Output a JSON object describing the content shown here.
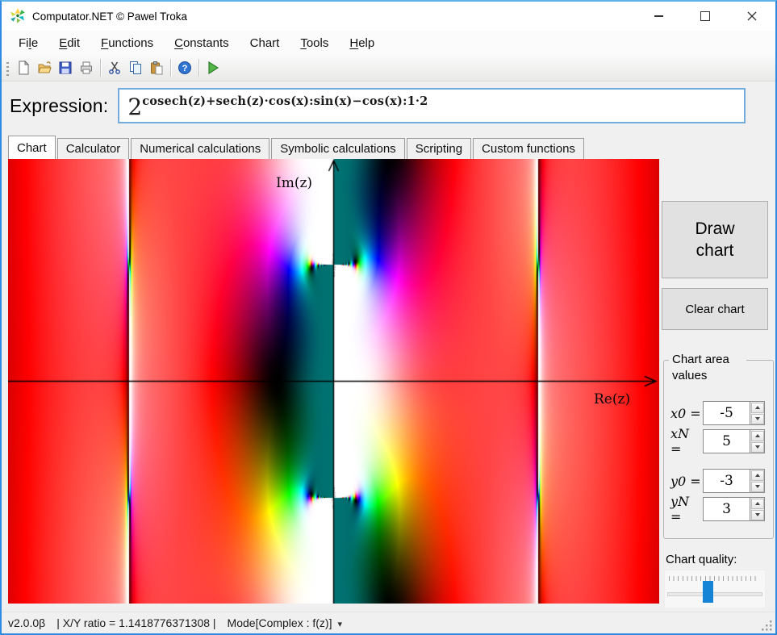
{
  "window": {
    "title": "Computator.NET © Pawel Troka",
    "controls": [
      "minimize",
      "maximize",
      "close"
    ]
  },
  "menu": {
    "items": [
      {
        "pre": "Fi",
        "key": "l",
        "post": "e"
      },
      {
        "pre": "",
        "key": "E",
        "post": "dit"
      },
      {
        "pre": "",
        "key": "F",
        "post": "unctions"
      },
      {
        "pre": "",
        "key": "C",
        "post": "onstants"
      },
      {
        "pre": "Chart",
        "key": "",
        "post": ""
      },
      {
        "pre": "",
        "key": "T",
        "post": "ools"
      },
      {
        "pre": "",
        "key": "H",
        "post": "elp"
      }
    ]
  },
  "toolbar": {
    "buttons": [
      "new-file",
      "open-file",
      "save",
      "print",
      "cut",
      "copy",
      "paste",
      "help",
      "run"
    ]
  },
  "expression": {
    "label": "Expression:",
    "base": "2",
    "superscript": "cosech(z)+sech(z)·cos(x):sin(x)−cos(x):1·2"
  },
  "tabs": {
    "items": [
      "Chart",
      "Calculator",
      "Numerical calculations",
      "Symbolic calculations",
      "Scripting",
      "Custom functions"
    ]
  },
  "panel": {
    "draw_button": "Draw chart",
    "clear_button": "Clear chart",
    "group_title": "Chart area values",
    "fields": [
      {
        "label": "x0 =",
        "value": "-5"
      },
      {
        "label": "xN =",
        "value": "5"
      },
      {
        "label": "y0 =",
        "value": "-3"
      },
      {
        "label": "yN =",
        "value": "3"
      }
    ],
    "quality_label": "Chart quality:"
  },
  "status": {
    "version": "v2.0.0β",
    "ratio": "| X/Y ratio = 1.1418776371308 |",
    "mode": "Mode[Complex : f(z)]",
    "caret": "▾"
  },
  "chart_data": {
    "type": "heatmap",
    "subtype": "complex-domain-coloring",
    "expression": "2^(cosech(z)+sech(z)·cos(x):sin(x)−cos(x):1·2)",
    "x_range": [
      -5,
      5
    ],
    "y_range": [
      -3,
      3
    ],
    "x_axis_label": "Re(z)",
    "y_axis_label": "Im(z)",
    "features": {
      "poles_on_imaginary_axis": [
        1.5708,
        -1.5708,
        0
      ],
      "vertical_singular_lines_re": [
        -3.1416,
        3.1416
      ],
      "background_hue": "red"
    }
  }
}
